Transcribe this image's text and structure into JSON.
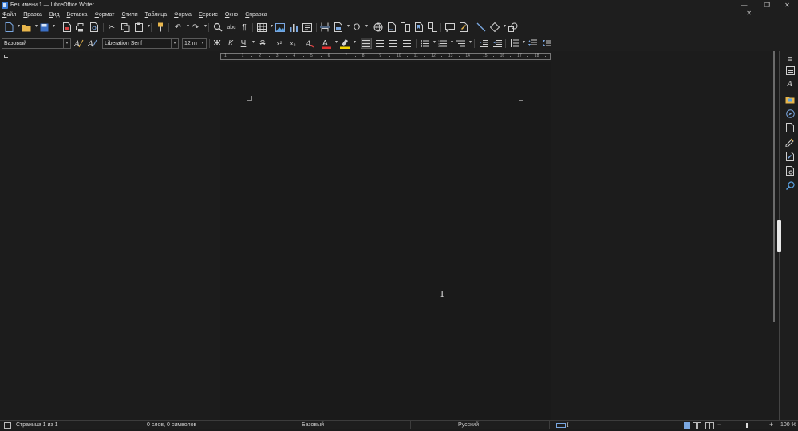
{
  "window": {
    "title": "Без имени 1 — LibreOffice Writer",
    "minimize": "—",
    "maximize": "❐",
    "close": "✕"
  },
  "menu": {
    "items": [
      "Файл",
      "Правка",
      "Вид",
      "Вставка",
      "Формат",
      "Стили",
      "Таблица",
      "Форма",
      "Сервис",
      "Окно",
      "Справка"
    ],
    "close_document": "✕"
  },
  "formatting": {
    "paragraph_style": "Базовый",
    "font_name": "Liberation Serif",
    "font_size": "12 пт",
    "bold": "Ж",
    "italic": "К",
    "underline": "Ч",
    "strikethrough": "S",
    "superscript": "x²",
    "subscript": "x₂"
  },
  "ruler": {
    "numbers": [
      "1",
      "1",
      "2",
      "3",
      "4",
      "5",
      "6",
      "7",
      "8",
      "9",
      "10",
      "11",
      "12",
      "13",
      "14",
      "15",
      "16",
      "17",
      "18"
    ]
  },
  "statusbar": {
    "page": "Страница 1 из 1",
    "words": "0 слов, 0 символов",
    "page_style": "Базовый",
    "language": "Русский",
    "zoom": "100 %",
    "zoom_minus": "−",
    "zoom_plus": "+"
  },
  "icons": {
    "toolbar1": [
      "new-document-icon",
      "open-icon",
      "save-icon",
      "export-pdf-icon",
      "print-icon",
      "print-preview-icon",
      "cut-icon",
      "copy-icon",
      "paste-icon",
      "clone-formatting-icon",
      "undo-icon",
      "redo-icon",
      "find-replace-icon",
      "spelling-icon",
      "formatting-marks-icon",
      "insert-table-icon",
      "insert-image-icon",
      "insert-chart-icon",
      "insert-textbox-icon",
      "insert-page-break-icon",
      "insert-field-icon",
      "insert-special-char-icon",
      "insert-hyperlink-icon",
      "insert-footnote-icon",
      "insert-endnote-icon",
      "insert-bookmark-icon",
      "insert-cross-reference-icon",
      "insert-comment-icon",
      "track-changes-icon",
      "insert-line-icon",
      "basic-shapes-icon",
      "draw-functions-icon"
    ],
    "sidebar": [
      "sidebar-menu-icon",
      "properties-icon",
      "styles-icon",
      "gallery-icon",
      "navigator-icon",
      "page-icon",
      "style-inspector-icon",
      "manage-changes-icon",
      "design-icon",
      "find-icon"
    ]
  },
  "colors": {
    "font_color": "#e03030",
    "highlight_color": "#f4d400",
    "accent": "#3a7bd5"
  }
}
